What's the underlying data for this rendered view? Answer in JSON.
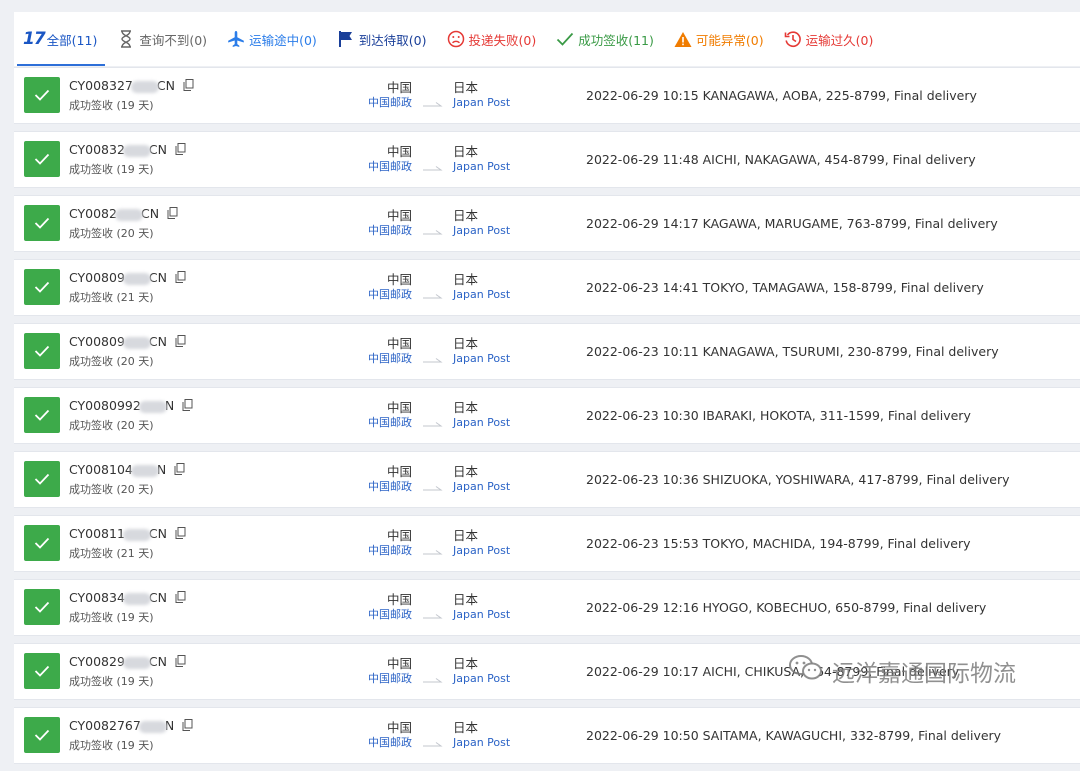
{
  "tabs": [
    {
      "label": "全部(11)",
      "badge": "17",
      "icon": "logo-badge-icon",
      "color": "#1a56c4",
      "active": true
    },
    {
      "label": "查询不到(0)",
      "icon": "hourglass-icon",
      "color": "#666666"
    },
    {
      "label": "运输途中(0)",
      "icon": "airplane-icon",
      "color": "#2b7de9"
    },
    {
      "label": "到达待取(0)",
      "icon": "flag-icon",
      "color": "#1a3f99"
    },
    {
      "label": "投递失败(0)",
      "icon": "sad-face-icon",
      "color": "#e53935"
    },
    {
      "label": "成功签收(11)",
      "icon": "checkmark-icon",
      "color": "#3a9a46"
    },
    {
      "label": "可能异常(0)",
      "icon": "warning-icon",
      "color": "#f07c00"
    },
    {
      "label": "运输过久(0)",
      "icon": "history-clock-icon",
      "color": "#e53935"
    }
  ],
  "shipments": [
    {
      "prefix": "CY008327",
      "suffix": "CN",
      "status": "成功签收 (19 天)",
      "origin": "中国",
      "origin_carrier": "中国邮政",
      "dest": "日本",
      "dest_carrier": "Japan Post",
      "event": "2022-06-29 10:15  KANAGAWA, AOBA, 225-8799, Final delivery"
    },
    {
      "prefix": "CY00832",
      "suffix": "CN",
      "status": "成功签收 (19 天)",
      "origin": "中国",
      "origin_carrier": "中国邮政",
      "dest": "日本",
      "dest_carrier": "Japan Post",
      "event": "2022-06-29 11:48  AICHI, NAKAGAWA, 454-8799, Final delivery"
    },
    {
      "prefix": "CY0082",
      "suffix": "CN",
      "status": "成功签收 (20 天)",
      "origin": "中国",
      "origin_carrier": "中国邮政",
      "dest": "日本",
      "dest_carrier": "Japan Post",
      "event": "2022-06-29 14:17  KAGAWA, MARUGAME, 763-8799, Final delivery"
    },
    {
      "prefix": "CY00809",
      "suffix": "CN",
      "status": "成功签收 (21 天)",
      "origin": "中国",
      "origin_carrier": "中国邮政",
      "dest": "日本",
      "dest_carrier": "Japan Post",
      "event": "2022-06-23 14:41  TOKYO, TAMAGAWA, 158-8799, Final delivery"
    },
    {
      "prefix": "CY00809",
      "suffix": "CN",
      "status": "成功签收 (20 天)",
      "origin": "中国",
      "origin_carrier": "中国邮政",
      "dest": "日本",
      "dest_carrier": "Japan Post",
      "event": "2022-06-23 10:11  KANAGAWA, TSURUMI, 230-8799, Final delivery"
    },
    {
      "prefix": "CY0080992",
      "suffix": "N",
      "status": "成功签收 (20 天)",
      "origin": "中国",
      "origin_carrier": "中国邮政",
      "dest": "日本",
      "dest_carrier": "Japan Post",
      "event": "2022-06-23 10:30  IBARAKI, HOKOTA, 311-1599, Final delivery"
    },
    {
      "prefix": "CY008104",
      "suffix": "N",
      "status": "成功签收 (20 天)",
      "origin": "中国",
      "origin_carrier": "中国邮政",
      "dest": "日本",
      "dest_carrier": "Japan Post",
      "event": "2022-06-23 10:36  SHIZUOKA, YOSHIWARA, 417-8799, Final delivery"
    },
    {
      "prefix": "CY00811",
      "suffix": "CN",
      "status": "成功签收 (21 天)",
      "origin": "中国",
      "origin_carrier": "中国邮政",
      "dest": "日本",
      "dest_carrier": "Japan Post",
      "event": "2022-06-23 15:53  TOKYO, MACHIDA, 194-8799, Final delivery"
    },
    {
      "prefix": "CY00834",
      "suffix": "CN",
      "status": "成功签收 (19 天)",
      "origin": "中国",
      "origin_carrier": "中国邮政",
      "dest": "日本",
      "dest_carrier": "Japan Post",
      "event": "2022-06-29 12:16  HYOGO, KOBECHUO, 650-8799, Final delivery"
    },
    {
      "prefix": "CY00829",
      "suffix": "CN",
      "status": "成功签收 (19 天)",
      "origin": "中国",
      "origin_carrier": "中国邮政",
      "dest": "日本",
      "dest_carrier": "Japan Post",
      "event": "2022-06-29 10:17  AICHI, CHIKUSA, 464-8799, Final delivery"
    },
    {
      "prefix": "CY0082767",
      "suffix": "N",
      "status": "成功签收 (19 天)",
      "origin": "中国",
      "origin_carrier": "中国邮政",
      "dest": "日本",
      "dest_carrier": "Japan Post",
      "event": "2022-06-29 10:50  SAITAMA, KAWAGUCHI, 332-8799, Final delivery"
    }
  ],
  "watermark": {
    "text": "远洋嘉通国际物流",
    "icon": "wechat-icon"
  },
  "colors": {
    "success": "#3daa4a",
    "link": "#2b63c6",
    "active_tab": "#2d6fd8"
  }
}
